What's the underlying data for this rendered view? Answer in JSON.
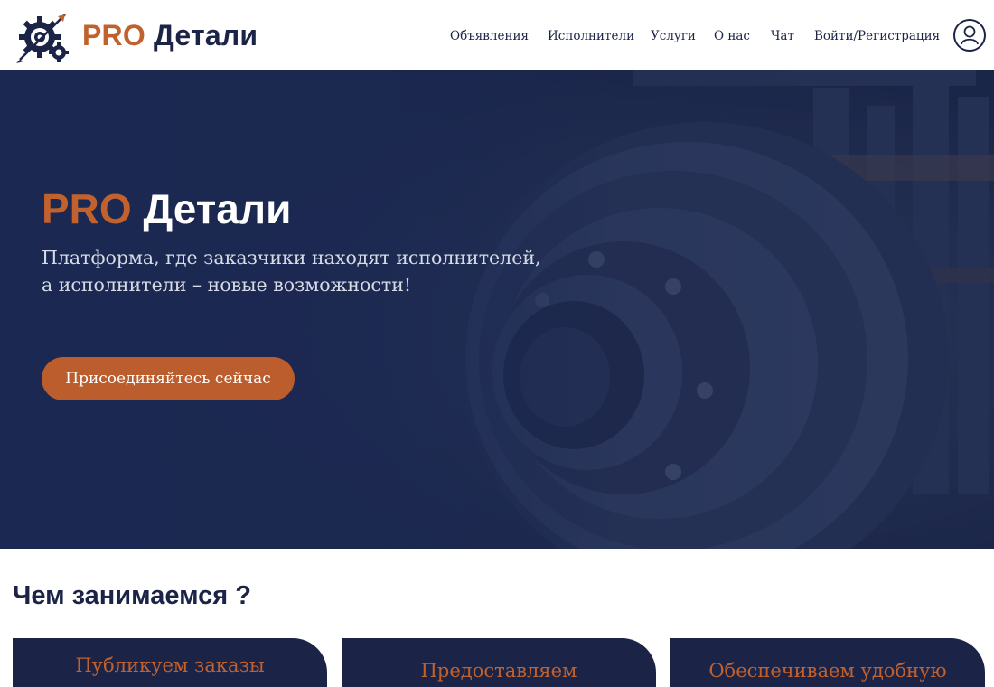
{
  "header": {
    "logo": {
      "pro": "PRO",
      "brand": "Детали",
      "icon": "gear-logo-icon"
    },
    "nav": [
      {
        "label": "Объявления"
      },
      {
        "label": "Исполнители"
      },
      {
        "label": "Услуги"
      },
      {
        "label": "О нас"
      },
      {
        "label": "Чат"
      },
      {
        "label": "Войти/Регистрация"
      }
    ],
    "profile_icon": "user-icon"
  },
  "hero": {
    "title_pro": "PRO",
    "title_brand": "Детали",
    "subtitle_line1": "Платформа, где заказчики находят исполнителей,",
    "subtitle_line2": "а исполнители – новые возможности!",
    "cta": "Присоединяйтесь сейчас",
    "background": "machinery-photo"
  },
  "services": {
    "title": "Чем занимаемся ?",
    "cards": [
      {
        "title": "Публикуем заказы"
      },
      {
        "title": "Предоставляем"
      },
      {
        "title": "Обеспечиваем удобную"
      }
    ]
  },
  "colors": {
    "accent": "#c0612e",
    "navy": "#1b2447",
    "white": "#ffffff"
  }
}
